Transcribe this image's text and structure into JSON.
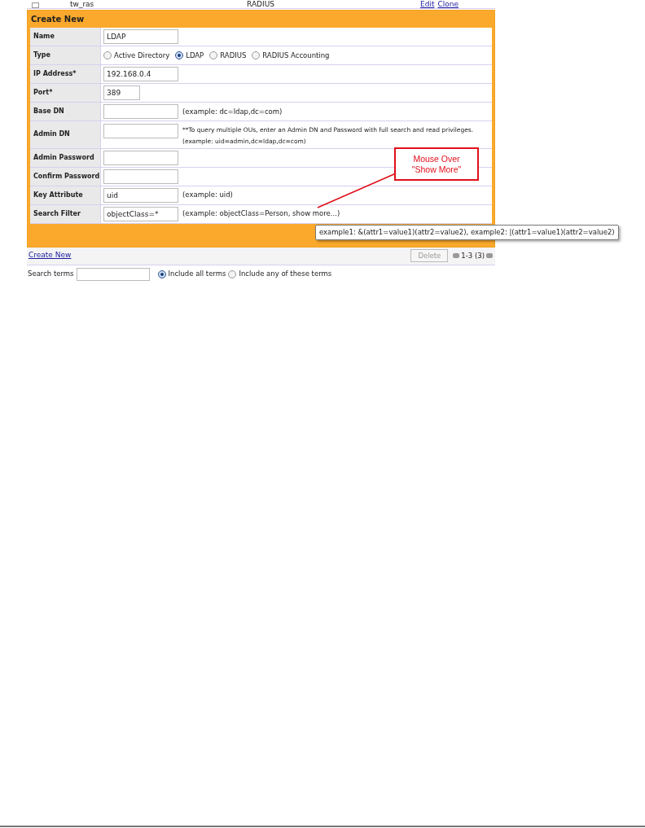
{
  "list_row": {
    "checked": false,
    "name": "tw_ras",
    "type": "RADIUS",
    "links": [
      "Edit",
      "Clone"
    ]
  },
  "form": {
    "title": "Create New",
    "fields": [
      {
        "kind": "text",
        "label": "Name",
        "value": "LDAP"
      },
      {
        "kind": "radio",
        "label": "Type",
        "options": [
          {
            "label": "Active Directory",
            "selected": false
          },
          {
            "label": "LDAP",
            "selected": true
          },
          {
            "label": "RADIUS",
            "selected": false
          },
          {
            "label": "RADIUS Accounting",
            "selected": false
          }
        ]
      },
      {
        "kind": "text",
        "label": "IP Address*",
        "value": "192.168.0.4"
      },
      {
        "kind": "short_text",
        "label": "Port*",
        "value": "389"
      },
      {
        "kind": "text",
        "label": "Base DN",
        "hints": [
          "(example: dc=ldap,dc=com)"
        ]
      },
      {
        "kind": "text",
        "label": "Admin DN",
        "hints": [
          "**To query multiple OUs, enter an Admin DN and Password with full search and read privileges.",
          "(example: uid=admin,dc=ldap,dc=com)"
        ]
      },
      {
        "kind": "text",
        "label": "Admin Password"
      },
      {
        "kind": "text",
        "label": "Confirm Password"
      },
      {
        "kind": "text",
        "label": "Key Attribute",
        "value": "uid",
        "hints": [
          "(example: uid)"
        ]
      },
      {
        "kind": "text",
        "label": "Search Filter",
        "value": "objectClass=*",
        "hints": [
          "(example: objectClass=Person, show more...)"
        ]
      }
    ]
  },
  "tooltip": "example1: &(attr1=value1)(attr2=value2), example2: |(attr1=value1)(attr2=value2)",
  "footer": {
    "create_link": "Create New",
    "delete_button": {
      "label": "Delete",
      "disabled": true
    },
    "pager": "1-3 (3)"
  },
  "search": {
    "label": "Search terms",
    "options": [
      {
        "label": "Include all terms",
        "selected": true
      },
      {
        "label": "Include any of these terms",
        "selected": false
      }
    ]
  },
  "callout": {
    "lines": [
      "Mouse Over",
      "\"Show More\""
    ]
  }
}
